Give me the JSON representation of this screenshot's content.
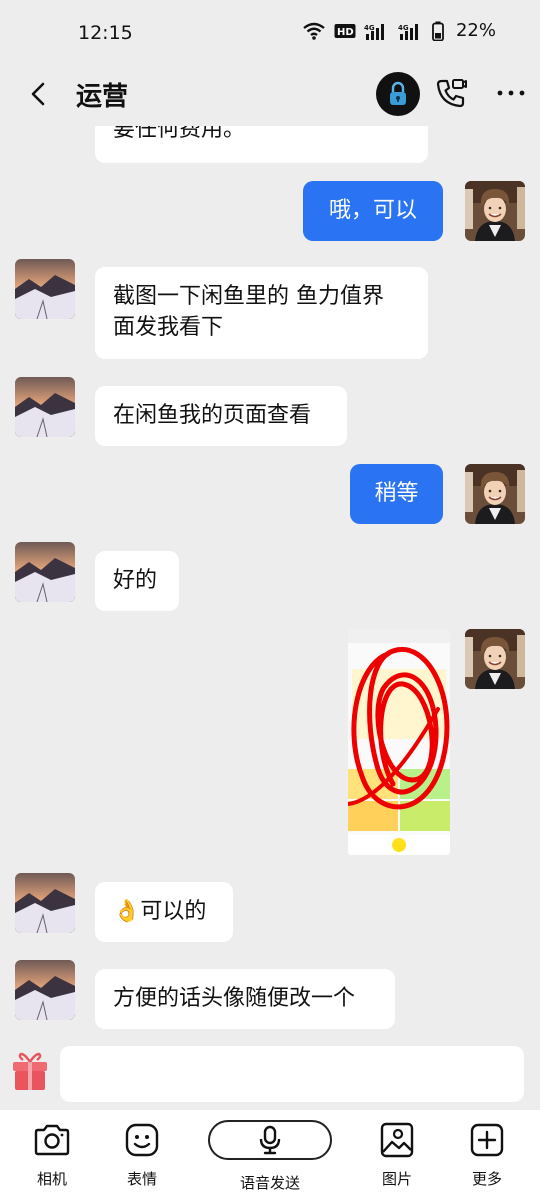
{
  "status_bar": {
    "time": "12:15",
    "battery_percent": "22%",
    "icons": [
      "wifi-icon",
      "hd-icon",
      "signal-4g-icon",
      "signal-4g-icon",
      "battery-icon"
    ]
  },
  "header": {
    "title": "运营",
    "icons": [
      "back-icon",
      "lock-icon",
      "video-call-icon",
      "more-icon"
    ]
  },
  "messages": [
    {
      "side": "in",
      "text": "要任何费用。",
      "partial": true
    },
    {
      "side": "out",
      "text": "哦，可以"
    },
    {
      "side": "in",
      "text_lines": [
        "截图一下闲鱼里的 鱼力值界",
        "面发我看下"
      ]
    },
    {
      "side": "in",
      "text": "在闲鱼我的页面查看"
    },
    {
      "side": "out",
      "text": "稍等"
    },
    {
      "side": "in",
      "text": "好的"
    },
    {
      "side": "out",
      "type": "image",
      "description": "screenshot-with-red-scribble"
    },
    {
      "side": "in",
      "emoji": "👌",
      "text": "可以的"
    },
    {
      "side": "in",
      "text": "方便的话头像随便改一个"
    }
  ],
  "input": {
    "value": "",
    "placeholder": ""
  },
  "toolbar": {
    "camera_label": "相机",
    "emoji_label": "表情",
    "voice_label": "语音发送",
    "image_label": "图片",
    "more_label": "更多"
  },
  "colors": {
    "background": "#ededed",
    "outgoing_bubble": "#2a73f2",
    "incoming_bubble": "#ffffff"
  }
}
